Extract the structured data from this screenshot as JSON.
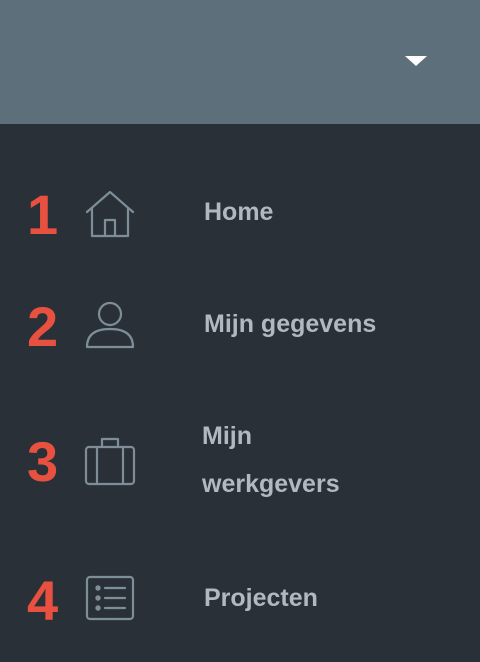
{
  "header": {
    "dropdown_icon": "caret-down-icon"
  },
  "menu": {
    "items": [
      {
        "number": "1",
        "icon": "home-icon",
        "label": "Home"
      },
      {
        "number": "2",
        "icon": "user-icon",
        "label": "Mijn gegevens"
      },
      {
        "number": "3",
        "icon": "briefcase-icon",
        "label_line1": "Mijn",
        "label_line2": "werkgevers"
      },
      {
        "number": "4",
        "icon": "list-icon",
        "label": "Projecten"
      }
    ]
  },
  "colors": {
    "header_bg": "#5d6f7b",
    "menu_bg": "#2a3038",
    "number": "#e8503f",
    "label": "#b1b8bf",
    "icon": "#7e8e99"
  }
}
